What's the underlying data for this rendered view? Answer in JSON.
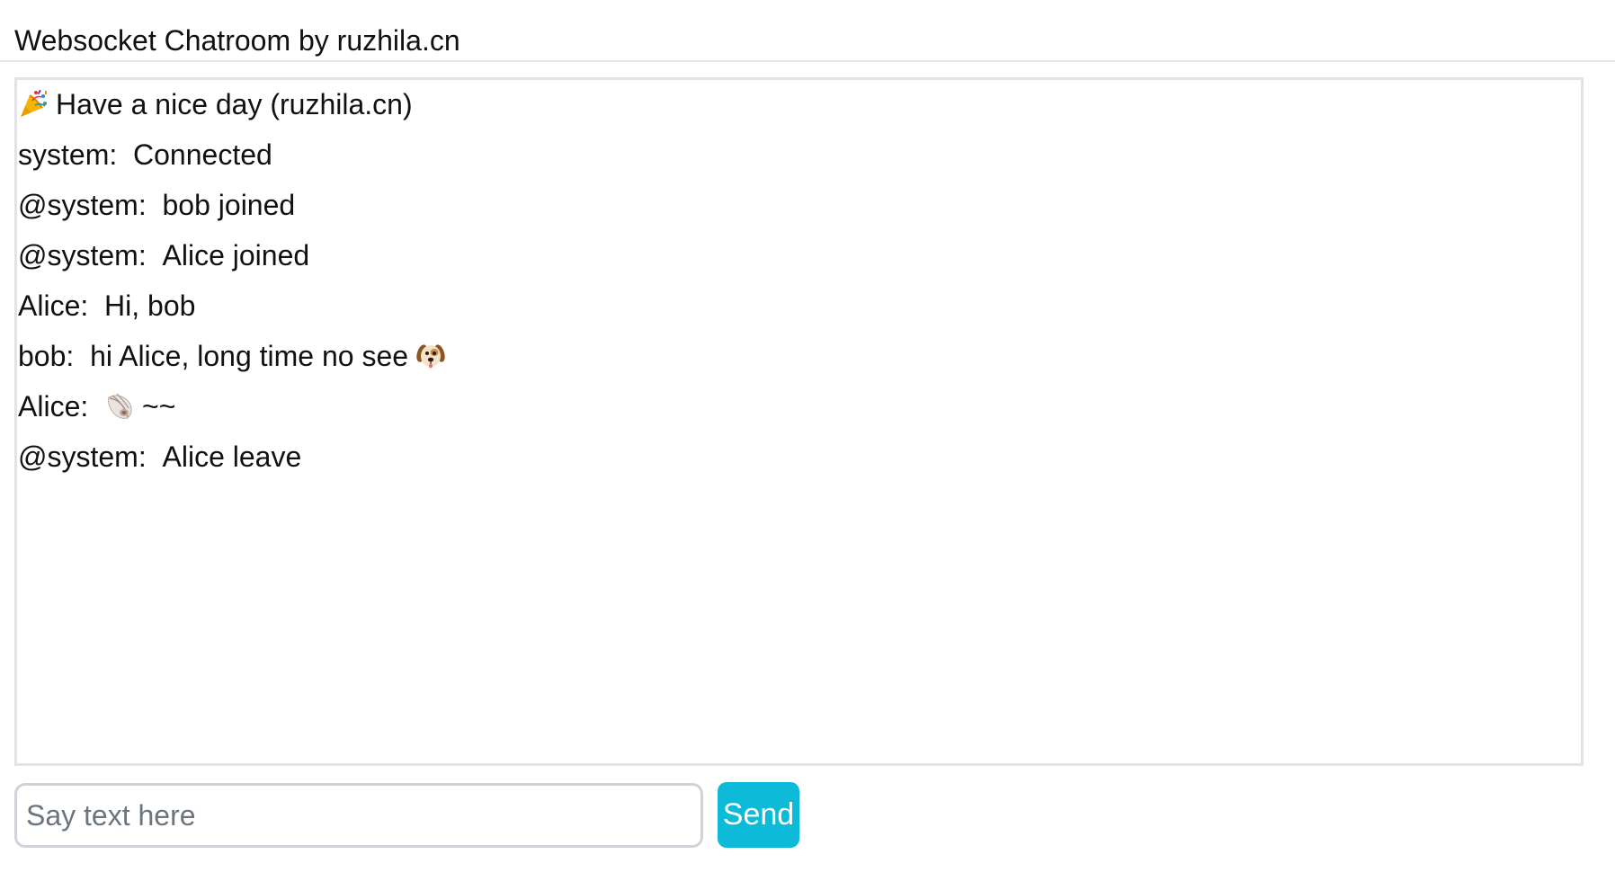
{
  "header": {
    "title": "Websocket Chatroom by ruzhila.cn"
  },
  "chat": {
    "banner": {
      "icon": "party-popper-icon",
      "text": "Have a nice day (ruzhila.cn)"
    },
    "messages": [
      {
        "sender": "system",
        "text": "Connected"
      },
      {
        "sender": "@system",
        "text": "bob joined"
      },
      {
        "sender": "@system",
        "text": "Alice joined"
      },
      {
        "sender": "Alice",
        "text": "Hi, bob"
      },
      {
        "sender": "bob",
        "text": "hi Alice, long time no see",
        "trailing_icon": "dog-face-icon"
      },
      {
        "sender": "Alice",
        "leading_icon": "spiral-shell-icon",
        "text": "~~"
      },
      {
        "sender": "@system",
        "text": "Alice leave"
      }
    ]
  },
  "composer": {
    "value": "",
    "placeholder": "Say text here"
  },
  "send_button": {
    "label": "Send"
  },
  "colors": {
    "accent": "#0dbbd8",
    "border": "#e3e3e3",
    "input_border": "#cfd3d8",
    "placeholder": "#6c757d"
  }
}
